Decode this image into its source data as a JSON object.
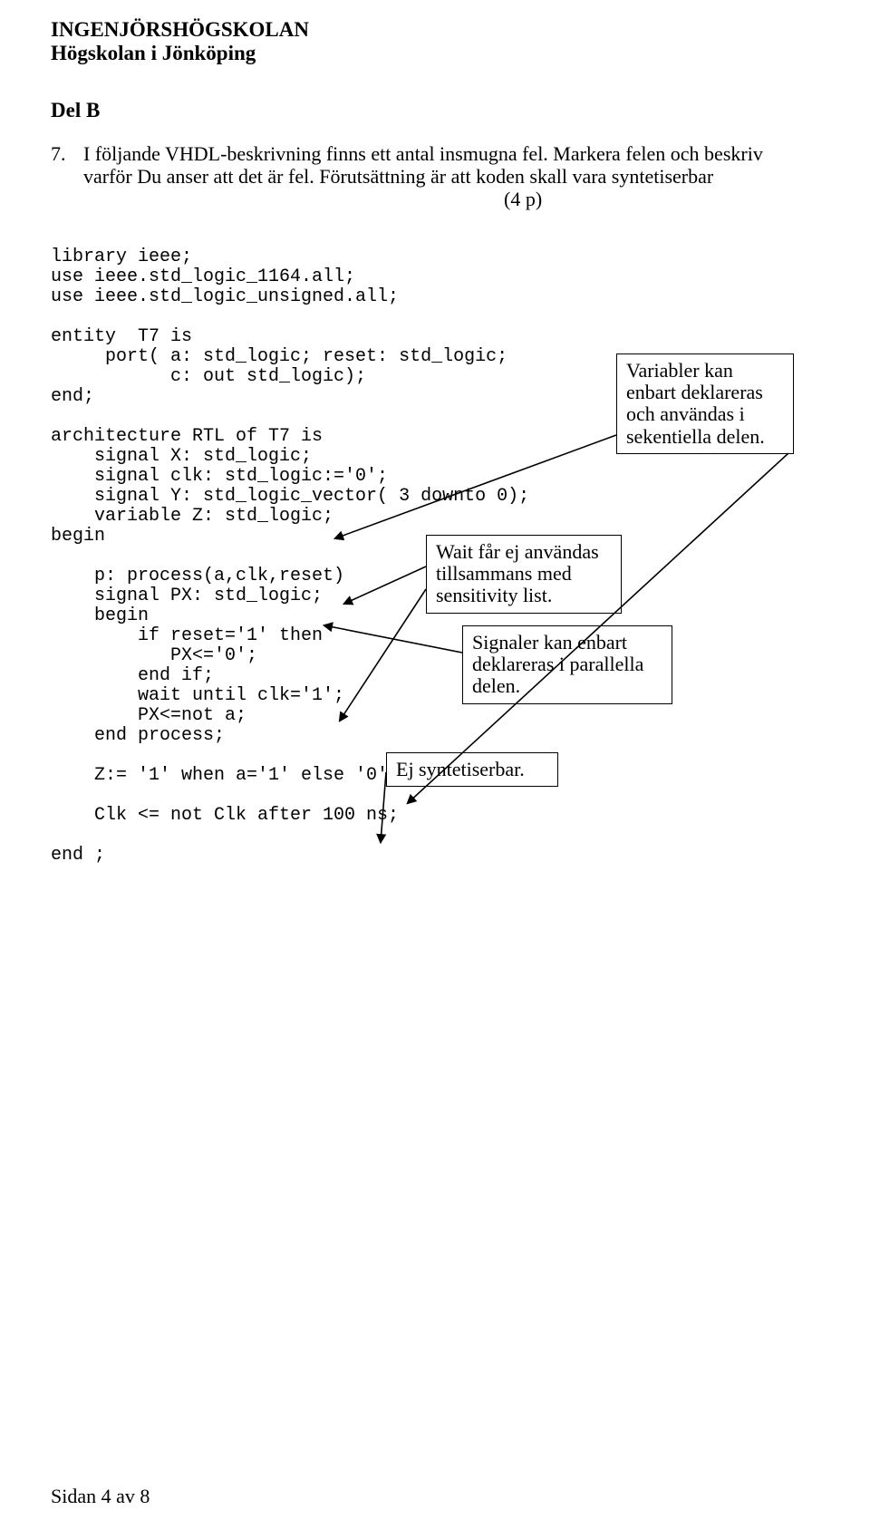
{
  "header": {
    "l1": "INGENJÖRSHÖGSKOLAN",
    "l2": "Högskolan i Jönköping"
  },
  "section": "Del B",
  "question": {
    "num": "7.",
    "l1": "I följande VHDL-beskrivning finns ett antal insmugna fel. Markera felen och beskriv",
    "l2": "varför Du anser att det är fel. Förutsättning är att koden skall vara syntetiserbar",
    "points": "(4 p)"
  },
  "code": {
    "l00": "library ieee;",
    "l01": "use ieee.std_logic_1164.all;",
    "l02": "use ieee.std_logic_unsigned.all;",
    "l03": "",
    "l04": "entity  T7 is",
    "l05": "     port( a: std_logic; reset: std_logic;",
    "l06": "           c: out std_logic);",
    "l07": "end;",
    "l08": "",
    "l09": "architecture RTL of T7 is",
    "l10": "    signal X: std_logic;",
    "l11": "    signal clk: std_logic:='0';",
    "l12": "    signal Y: std_logic_vector( 3 downto 0);",
    "l13": "    variable Z: std_logic;",
    "l14": "begin",
    "l15": "",
    "l16": "    p: process(a,clk,reset)",
    "l17": "    signal PX: std_logic;",
    "l18": "    begin",
    "l19": "        if reset='1' then",
    "l20": "           PX<='0';",
    "l21": "        end if;",
    "l22": "        wait until clk='1';",
    "l23": "        PX<=not a;",
    "l24": "    end process;",
    "l25": "",
    "l26": "    Z:= '1' when a='1' else '0';",
    "l27": "",
    "l28": "    Clk <= not Clk after 100 ns;",
    "l29": "",
    "l30": "end ;"
  },
  "annotations": {
    "a1": "Variabler kan enbart deklareras och användas i sekentiella delen.",
    "a2": "Wait får ej användas tillsammans med sensitivity list.",
    "a3": "Signaler kan enbart deklareras i parallella delen.",
    "a4": "Ej syntetiserbar."
  },
  "footer": "Sidan 4 av 8"
}
